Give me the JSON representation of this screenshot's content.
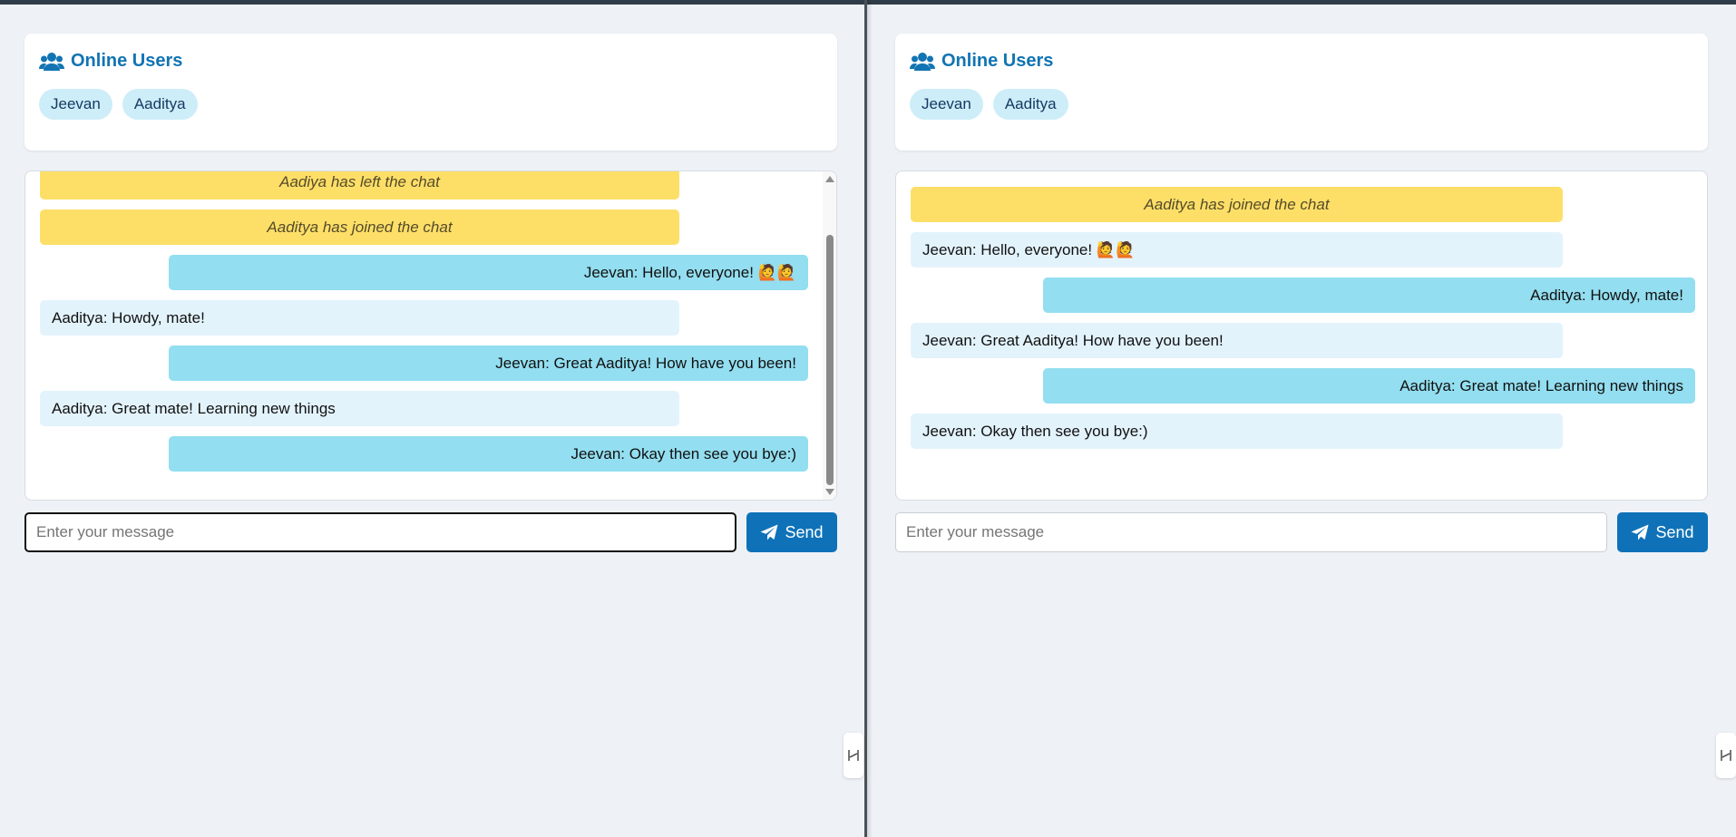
{
  "colors": {
    "accent": "#1174b3",
    "send_button": "#0f72b8",
    "system_message": "#fddf68",
    "outgoing_message": "#93def0",
    "incoming_message": "#e3f3fc",
    "chip": "#cdedf8"
  },
  "panes": [
    {
      "users_panel": {
        "title": "Online Users",
        "icon": "users-icon",
        "users": [
          "Jeevan",
          "Aaditya"
        ]
      },
      "messages": [
        {
          "type": "system",
          "text": "Aadiya has left the chat"
        },
        {
          "type": "system",
          "text": "Aaditya has joined the chat"
        },
        {
          "type": "out",
          "text": "Jeevan: Hello, everyone! 🙋🙋"
        },
        {
          "type": "in",
          "text": "Aaditya: Howdy, mate!"
        },
        {
          "type": "out",
          "text": "Jeevan: Great Aaditya! How have you been!"
        },
        {
          "type": "in",
          "text": "Aaditya: Great mate! Learning new things"
        },
        {
          "type": "out",
          "text": "Jeevan: Okay then see you bye:)"
        }
      ],
      "composer": {
        "placeholder": "Enter your message",
        "value": "",
        "send_label": "Send",
        "send_icon": "paper-plane-icon"
      }
    },
    {
      "users_panel": {
        "title": "Online Users",
        "icon": "users-icon",
        "users": [
          "Jeevan",
          "Aaditya"
        ]
      },
      "messages": [
        {
          "type": "system",
          "text": "Aaditya has joined the chat"
        },
        {
          "type": "in",
          "text": "Jeevan: Hello, everyone! 🙋🙋"
        },
        {
          "type": "out",
          "text": "Aaditya: Howdy, mate!"
        },
        {
          "type": "in",
          "text": "Jeevan: Great Aaditya! How have you been!"
        },
        {
          "type": "out",
          "text": "Aaditya: Great mate! Learning new things"
        },
        {
          "type": "in",
          "text": "Jeevan: Okay then see you bye:)"
        }
      ],
      "composer": {
        "placeholder": "Enter your message",
        "value": "",
        "send_label": "Send",
        "send_icon": "paper-plane-icon"
      }
    }
  ]
}
